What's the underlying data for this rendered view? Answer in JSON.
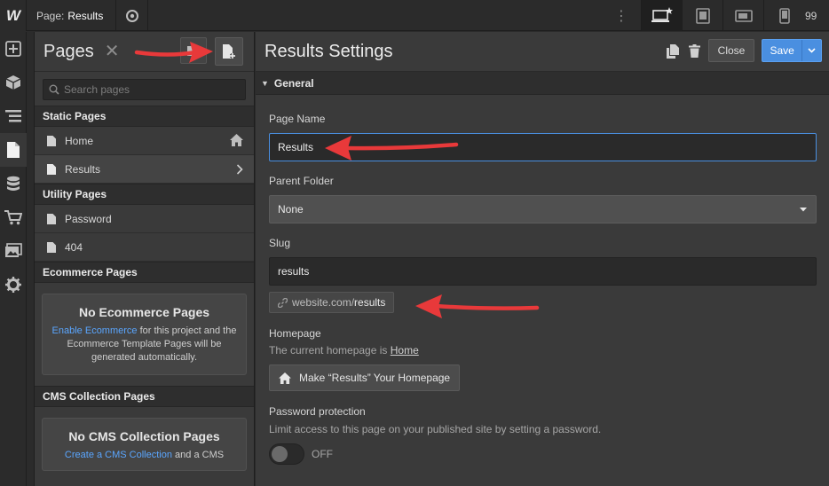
{
  "topbar": {
    "logo": "W",
    "page_prefix": "Page:",
    "page_name": "Results",
    "truncated_value": "99"
  },
  "rail": {
    "icons": [
      "add-icon",
      "box-icon",
      "navigator-icon",
      "pages-icon",
      "cms-icon",
      "ecommerce-icon",
      "assets-icon",
      "settings-icon"
    ]
  },
  "pages_panel": {
    "title": "Pages",
    "search_placeholder": "Search pages",
    "static_header": "Static Pages",
    "static_pages": [
      "Home",
      "Results"
    ],
    "utility_header": "Utility Pages",
    "utility_pages": [
      "Password",
      "404"
    ],
    "ecommerce_header": "Ecommerce Pages",
    "ecommerce_empty_title": "No Ecommerce Pages",
    "ecommerce_empty_link": "Enable Ecommerce",
    "ecommerce_empty_text": " for this project and the Ecommerce Template Pages will be generated automatically.",
    "cms_header": "CMS Collection Pages",
    "cms_empty_title": "No CMS Collection Pages",
    "cms_empty_link": "Create a CMS Collection",
    "cms_empty_text": " and a CMS"
  },
  "settings": {
    "title": "Results Settings",
    "close_label": "Close",
    "save_label": "Save",
    "section": "General",
    "page_name_label": "Page Name",
    "page_name_value": "Results",
    "parent_folder_label": "Parent Folder",
    "parent_folder_value": "None",
    "slug_label": "Slug",
    "slug_value": "results",
    "slug_url_prefix": "website.com/",
    "slug_url_slug": "results",
    "homepage_label": "Homepage",
    "homepage_text": "The current homepage is ",
    "homepage_link": "Home",
    "make_homepage_label": "Make “Results” Your Homepage",
    "password_label": "Password protection",
    "password_help": "Limit access to this page on your published site by setting a password.",
    "password_toggle": "OFF"
  },
  "colors": {
    "accent": "#4a8fe0",
    "annotation_arrow": "#e8393a",
    "link": "#5aa6ff"
  }
}
